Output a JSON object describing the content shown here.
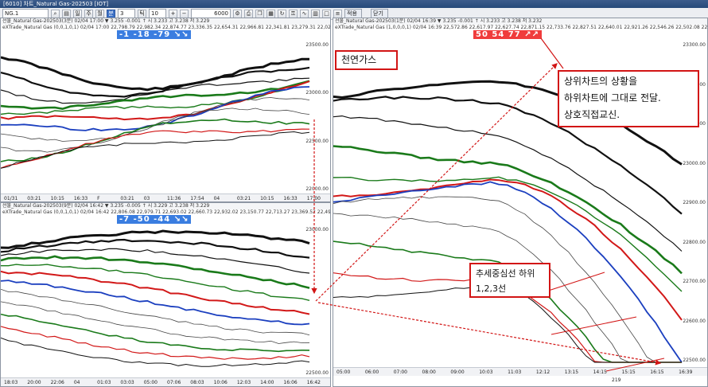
{
  "window": {
    "title": "[6010] 차트_Natural Gas-202503 [IOT]"
  },
  "toolbar": {
    "symbol": "NG.1",
    "period": "3",
    "count": "10",
    "bars": "6000",
    "btn_apply": "적용",
    "btn_close": "닫기"
  },
  "panel_top_left": {
    "head": "선물_Natural Gas-202503(3분) 02/04 17:00 ▼ 3.255 -0.001 ↑ 시 3.233 고 3.238 저 3.229",
    "sub": "eXTrade_Natural Gas (0,0,1,0,1) 02/04 17:00 22,798.79 22,982.34 22,874.77 23,336.35 22,654.31 22,966.81 22,341.81 23,279.31 22,029.31",
    "badge": "-1  -18  -79  ↘↘",
    "y_ticks": [
      "23500.00",
      "23000.00",
      "22500.00",
      "22000.00"
    ],
    "x_ticks": [
      "01/31",
      "03:21",
      "10:15",
      "16:33",
      "F",
      "03:21",
      "03",
      "11:36",
      "17:54",
      "04",
      "03:21",
      "10:15",
      "16:33",
      "17:00"
    ]
  },
  "panel_bottom_left": {
    "head": "선물_Natural Gas-202503(9분) 02/04 16:42 ▼ 3.235 -0.005 ↑ 시 3.229 고 3.238 저 3.229",
    "sub": "eXTrade_Natural Gas (0,0,1,0,1) 02/04 16:42 22,806.08 22,979.71 22,693.02 22,660.73 22,932.02 23,150.77 22,713.27 23,369.52 22,494.52",
    "badge": "-7  -50  -44  ↘↘",
    "y_ticks": [
      "23000.00",
      "22500.00"
    ],
    "x_ticks": [
      "18:03",
      "20:00",
      "22:06",
      "04",
      "01:03",
      "03:03",
      "05:00",
      "07:06",
      "08:03",
      "10:06",
      "12:03",
      "14:00",
      "16:06",
      "16:42"
    ]
  },
  "panel_right": {
    "head": "선물_Natural Gas-202503(1분) 02/04 16:39 ▼ 3.235 -0.001 ↑ 시 3.233 고 3.238 저 3.232",
    "sub": "eXTrade_Natural Gas (1,0,0,0,1) 02/04 16:39 22,572.86 22,617.97 22,627.74 22,871.15 22,733.76 22,827.51 22,640.01 22,921.26 22,546.26 22,502.08 22,889.11",
    "badge": "50  54  77  ↗↗",
    "y_ticks": [
      "23300.00",
      "23200.00",
      "23100.00",
      "23000.00",
      "22900.00",
      "22800.00",
      "22700.00",
      "22600.00",
      "22500.00"
    ],
    "x_ticks": [
      "05:00",
      "06:00",
      "07:00",
      "08:00",
      "09:00",
      "10:03",
      "11:03",
      "12:12",
      "13:15",
      "14:15",
      "15:15",
      "16:15",
      "16:39"
    ],
    "zoom": "219"
  },
  "annotations": {
    "label_natgas": "천연가스",
    "note_main": "상위차트의 상황을\n하위차트에 그대로 전달.\n상호직접교신.",
    "note_trend": "추세중심선 하위\n1,2,3선"
  },
  "colors": {
    "badge_red": "#f03c3c",
    "badge_blue": "#3a7de0",
    "annotation_red": "#d21515"
  }
}
